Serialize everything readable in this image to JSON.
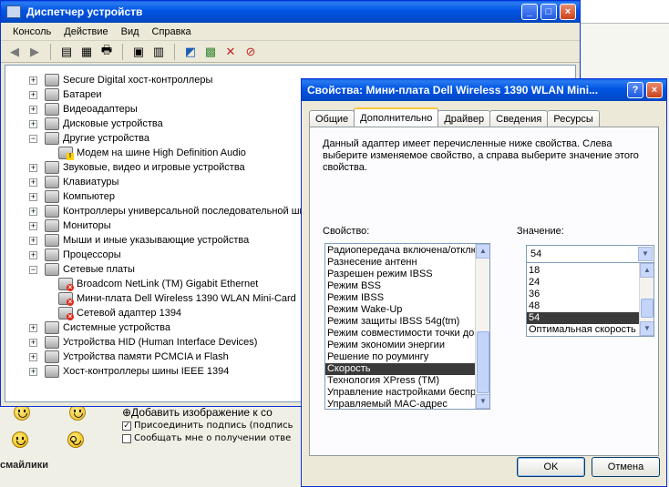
{
  "background": {
    "add_image_link": "⊕Добавить изображение к со",
    "attach_signature_label": "Присоединить подпись (подпись",
    "notify_label": "Сообщать мне о получении отве",
    "smileys_label": "смайлики"
  },
  "devmgr": {
    "title": "Диспетчер устройств",
    "menu": [
      "Консоль",
      "Действие",
      "Вид",
      "Справка"
    ],
    "tree": [
      {
        "label": "Secure Digital хост-контроллеры",
        "level": 1,
        "exp": "+"
      },
      {
        "label": "Батареи",
        "level": 1,
        "exp": "+"
      },
      {
        "label": "Видеоадаптеры",
        "level": 1,
        "exp": "+"
      },
      {
        "label": "Дисковые устройства",
        "level": 1,
        "exp": "+"
      },
      {
        "label": "Другие устройства",
        "level": 1,
        "exp": "−"
      },
      {
        "label": "Модем на шине High Definition Audio",
        "level": 2,
        "status": "warn"
      },
      {
        "label": "Звуковые, видео и игровые устройства",
        "level": 1,
        "exp": "+"
      },
      {
        "label": "Клавиатуры",
        "level": 1,
        "exp": "+"
      },
      {
        "label": "Компьютер",
        "level": 1,
        "exp": "+"
      },
      {
        "label": "Контроллеры универсальной последовательной ши",
        "level": 1,
        "exp": "+"
      },
      {
        "label": "Мониторы",
        "level": 1,
        "exp": "+"
      },
      {
        "label": "Мыши и иные указывающие устройства",
        "level": 1,
        "exp": "+"
      },
      {
        "label": "Процессоры",
        "level": 1,
        "exp": "+"
      },
      {
        "label": "Сетевые платы",
        "level": 1,
        "exp": "−"
      },
      {
        "label": "Broadcom NetLink (TM) Gigabit Ethernet",
        "level": 2,
        "status": "err"
      },
      {
        "label": "Мини-плата Dell Wireless 1390 WLAN Mini-Card",
        "level": 2,
        "status": "err"
      },
      {
        "label": "Сетевой адаптер 1394",
        "level": 2,
        "status": "err"
      },
      {
        "label": "Системные устройства",
        "level": 1,
        "exp": "+"
      },
      {
        "label": "Устройства HID (Human Interface Devices)",
        "level": 1,
        "exp": "+"
      },
      {
        "label": "Устройства памяти PCMCIA и Flash",
        "level": 1,
        "exp": "+"
      },
      {
        "label": "Хост-контроллеры шины IEEE 1394",
        "level": 1,
        "exp": "+"
      }
    ]
  },
  "props": {
    "title": "Свойства: Мини-плата Dell Wireless 1390 WLAN Mini...",
    "tabs": [
      "Общие",
      "Дополнительно",
      "Драйвер",
      "Сведения",
      "Ресурсы"
    ],
    "active_tab": "Дополнительно",
    "description": "Данный адаптер имеет перечисленные ниже свойства. Слева выберите изменяемое свойство, а справа выберите значение этого свойства.",
    "property_label": "Свойство:",
    "value_label": "Значение:",
    "properties": [
      "Радиопередача включена/отклю",
      "Разнесение антенн",
      "Разрешен режим IBSS",
      "Режим BSS",
      "Режим IBSS",
      "Режим Wake-Up",
      "Режим защиты IBSS 54g(tm)",
      "Режим совместимости точки до",
      "Режим экономии энергии",
      "Решение по роумингу",
      "Скорость",
      "Технология XPress (TM)",
      "Управление настройками беспр",
      "Управляемый MAC-адрес"
    ],
    "selected_property": "Скорость",
    "value_selected": "54",
    "value_options": [
      "18",
      "24",
      "36",
      "48",
      "54",
      "Оптимальная скорость"
    ],
    "ok": "OK",
    "cancel": "Отмена"
  }
}
